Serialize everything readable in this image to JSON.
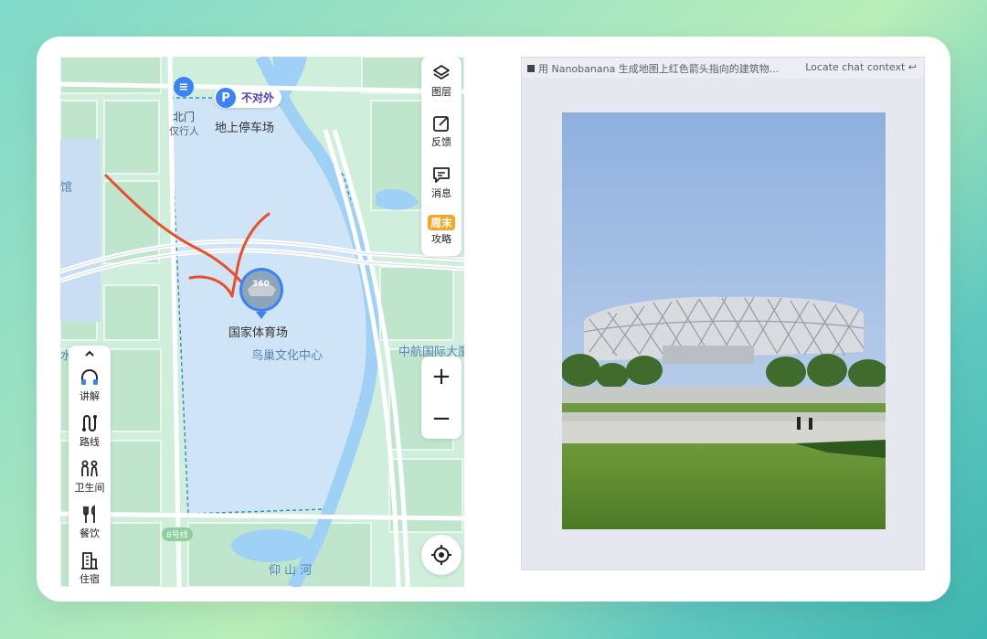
{
  "map": {
    "labels": {
      "north_gate": "北门",
      "pedestrian_only": "仅行人",
      "parking_tag": "不对外",
      "parking_lot": "地上停车场",
      "stadium": "国家体育场",
      "nest_center": "鸟巢文化中心",
      "aviation_building": "中航国际大厦",
      "museum_fragment": "馆",
      "water_fragment": "水",
      "river": "仰 山 河",
      "line_badge": "8号线",
      "photo_badge": "360"
    },
    "toolbar_right": [
      {
        "label": "图层",
        "icon": "layers-icon"
      },
      {
        "label": "反馈",
        "icon": "feedback-icon"
      },
      {
        "label": "消息",
        "icon": "message-icon"
      },
      {
        "label": "攻略",
        "icon": "weekend-guide-icon",
        "badge": "周末"
      }
    ],
    "zoom": {
      "in": "+",
      "out": "−"
    },
    "toolbar_left": [
      {
        "label": "讲解",
        "icon": "headphones-icon"
      },
      {
        "label": "路线",
        "icon": "route-icon"
      },
      {
        "label": "卫生间",
        "icon": "restroom-icon"
      },
      {
        "label": "餐饮",
        "icon": "dining-icon"
      },
      {
        "label": "住宿",
        "icon": "hotel-icon"
      }
    ],
    "colors": {
      "park": "#cfe4f7",
      "green": "#bfe9cc",
      "river": "#9fd0f5",
      "arrow": "#e8502a"
    }
  },
  "panel": {
    "title": "用 Nanobanana 生成地图上红色箭头指向的建筑物...",
    "link": "Locate chat context"
  }
}
